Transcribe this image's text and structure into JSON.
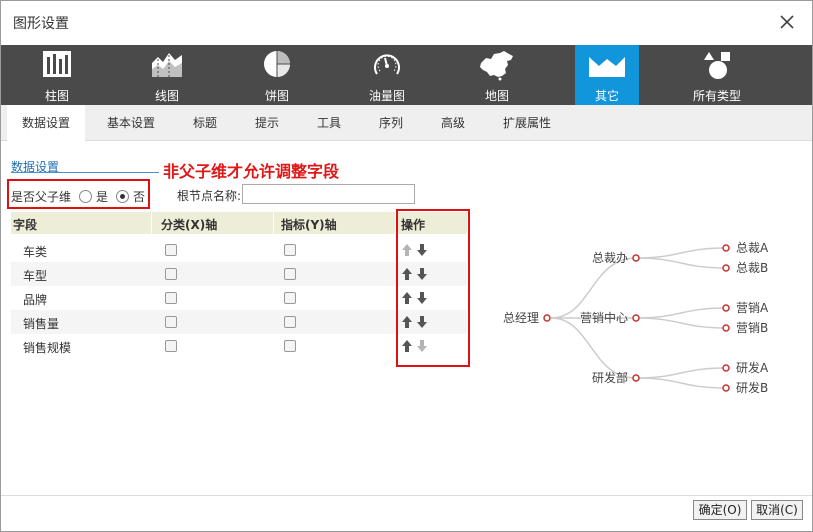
{
  "window": {
    "title": "图形设置"
  },
  "toolbar": {
    "items": [
      {
        "label": "柱图",
        "icon": "bar-chart-icon"
      },
      {
        "label": "线图",
        "icon": "area-chart-icon"
      },
      {
        "label": "饼图",
        "icon": "pie-chart-icon"
      },
      {
        "label": "油量图",
        "icon": "gauge-icon"
      },
      {
        "label": "地图",
        "icon": "china-map-icon"
      },
      {
        "label": "其它",
        "icon": "other-chart-icon"
      },
      {
        "label": "所有类型",
        "icon": "all-types-icon"
      }
    ],
    "active_index": 5
  },
  "tabs": {
    "items": [
      "数据设置",
      "基本设置",
      "标题",
      "提示",
      "工具",
      "序列",
      "高级",
      "扩展属性"
    ],
    "active_index": 0
  },
  "data_settings": {
    "section_title": "数据设置",
    "annotation": "非父子维才允许调整字段",
    "parent_child_label": "是否父子维",
    "option_yes": "是",
    "option_no": "否",
    "selected": "否",
    "root_name_label": "根节点名称:",
    "root_name_value": ""
  },
  "table": {
    "headers": [
      "字段",
      "分类(X)轴",
      "指标(Y)轴",
      "操作"
    ],
    "rows": [
      {
        "field": "车类",
        "x_axis": false,
        "y_axis": false,
        "up_enabled": false,
        "down_enabled": true
      },
      {
        "field": "车型",
        "x_axis": false,
        "y_axis": false,
        "up_enabled": true,
        "down_enabled": true
      },
      {
        "field": "品牌",
        "x_axis": false,
        "y_axis": false,
        "up_enabled": true,
        "down_enabled": true
      },
      {
        "field": "销售量",
        "x_axis": false,
        "y_axis": false,
        "up_enabled": true,
        "down_enabled": true
      },
      {
        "field": "销售规模",
        "x_axis": false,
        "y_axis": false,
        "up_enabled": true,
        "down_enabled": false
      }
    ]
  },
  "tree_preview": {
    "root": "总经理",
    "level1": [
      "总裁办",
      "营销中心",
      "研发部"
    ],
    "level2": [
      [
        "总裁A",
        "总裁B"
      ],
      [
        "营销A",
        "营销B"
      ],
      [
        "研发A",
        "研发B"
      ]
    ],
    "node_color": "#c23531"
  },
  "footer": {
    "ok_label": "确定(O)",
    "cancel_label": "取消(C)"
  },
  "colors": {
    "toolbar_bg": "#4a4a4a",
    "active_tool": "#1196db",
    "annotation": "#e01818",
    "highlight_box": "#dd1111"
  }
}
